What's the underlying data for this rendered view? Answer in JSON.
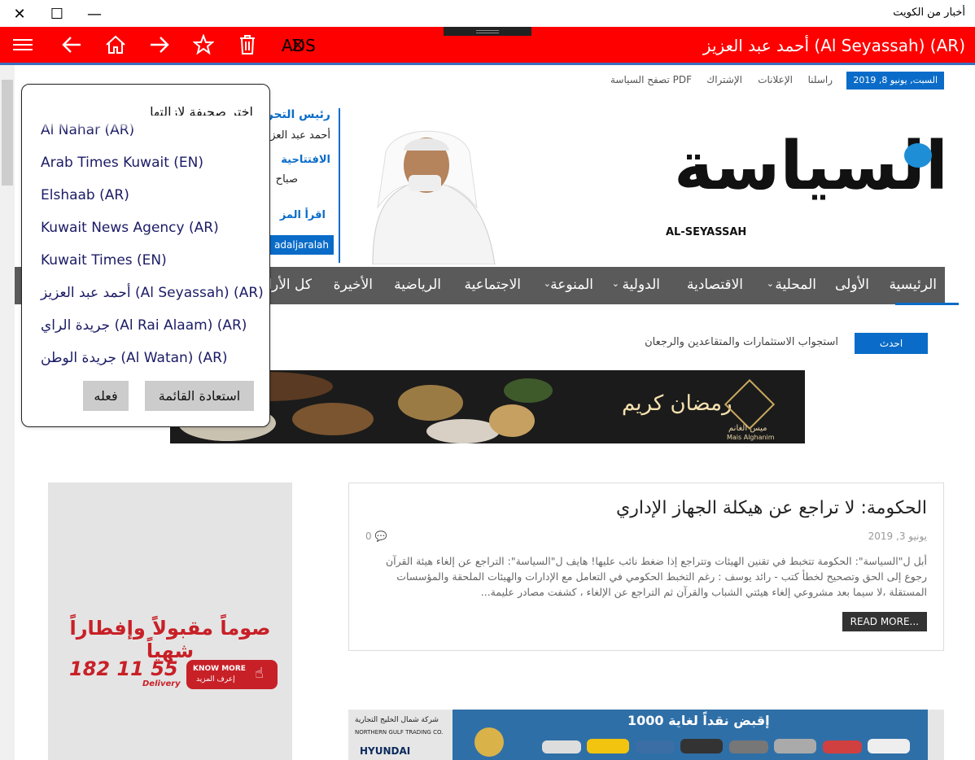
{
  "window": {
    "title": "أخبار من الكويت",
    "close_glyph": "✕",
    "max_glyph": "☐",
    "min_glyph": "—"
  },
  "appbar": {
    "paper_title": "أحمد عبد العزيز (Al Seyassah) (AR)",
    "ads_label": "ADS"
  },
  "site": {
    "date": "السبت, يونيو 8, 2019",
    "links": [
      "راسلنا",
      "الإعلانات",
      "الإشتراك",
      "تصفح السياسة PDF"
    ],
    "logo_ar": "السياسة",
    "logo_en": "AL-SEYASSAH",
    "sidebar_editor": {
      "label1": "رئيس التحرير",
      "name": "أحمد عبد العزيز",
      "label2": "الافتتاحية",
      "line": "صباح",
      "read": "اقرأ المز",
      "twitter": "adaljaralah"
    },
    "nav": [
      "الرئيسية",
      "الأولى",
      "المحلية",
      "الاقتصادية",
      "الدولية",
      "المنوعة",
      "الاجتماعية",
      "الرياضية",
      "الأخيرة",
      "كل الأرا"
    ],
    "ticker_label": "احدث",
    "ticker_text": "استجواب الاستثمارات والمتقاعدين والرجعان",
    "banner_text": "رمضان كريم",
    "banner_brand": "ميس الغانم",
    "banner_brand_en": "Mais Alghanim",
    "article": {
      "title": "الحكومة: لا تراجع عن هيكلة الجهاز الإداري",
      "date": "يونيو 3, 2019",
      "comments": "0",
      "body": "أبل ل\"السياسة\": الحكومة تتخبط في تقنين الهيئات وتتراجع إذا ضغط نائب عليها! هايف ل\"السياسة\": التراجع عن إلغاء هيئة القرآن رجوع إلى الحق وتصحيح لخطأ كتب - رائد يوسف : رغم التخبط الحكومي في التعامل مع الإدارات والهيئات الملحقة والمؤسسات المستقلة ،لا سيما بعد مشروعي إلغاء هيئتي الشباب والقرآن ثم التراجع عن الإلغاء ، كشفت مصادر عليمة...",
      "read_more": "READ MORE..."
    },
    "ad_left": {
      "slogan": "صوماً مقبولاً وإفطاراً شهياً",
      "phone": "182 11 55",
      "delivery": "Delivery",
      "know_more": "KNOW MORE",
      "know_more_ar": "إعرف المزيد"
    },
    "ad_bottom": {
      "company": "شركة شمال الخليج التجارية",
      "company_en": "NORTHERN GULF TRADING CO.",
      "brand": "HYUNDAI",
      "offer": "إقبض نقداً لغاية 1000"
    }
  },
  "popup": {
    "title": "اختر صحيفة لإزالتها",
    "items": [
      "Al Nahar (AR)",
      "Arab Times Kuwait (EN)",
      "Elshaab (AR)",
      "Kuwait News Agency (AR)",
      "Kuwait Times (EN)",
      "أحمد عبد العزيز (Al Seyassah) (AR)",
      "جريدة الراي (Al Rai Alaam) (AR)",
      "جريدة الوطن (Al Watan) (AR)"
    ],
    "restore_label": "استعادة القائمة",
    "do_label": "فعله"
  },
  "colors": {
    "appbar": "#ff0000",
    "accent": "#0a6cc8",
    "nav": "#5a5a5a"
  }
}
